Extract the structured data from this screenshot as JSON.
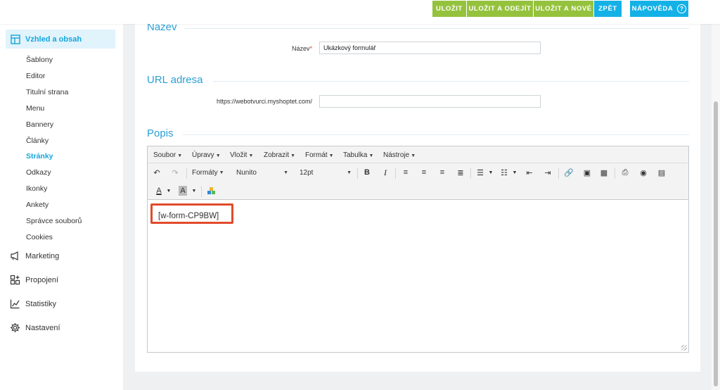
{
  "toolbar": {
    "save": "ULOŽIT",
    "save_exit": "ULOŽIT A ODEJÍT",
    "save_new": "ULOŽIT A NOVÉ",
    "back": "ZPĚT",
    "help": "NÁPOVĚDA",
    "help_icon_glyph": "?",
    "colors": {
      "green": "#95c23d",
      "blue": "#14b1e7"
    }
  },
  "sidebar": {
    "active_section": "Vzhled a obsah",
    "sub_items": [
      "Šablony",
      "Editor",
      "Titulní strana",
      "Menu",
      "Bannery",
      "Články",
      "Stránky",
      "Odkazy",
      "Ikonky",
      "Ankety",
      "Správce souborů",
      "Cookies"
    ],
    "current_sub": "Stránky",
    "main_items": [
      {
        "label": "Marketing",
        "icon": "megaphone-icon"
      },
      {
        "label": "Propojení",
        "icon": "grid-plus-icon"
      },
      {
        "label": "Statistiky",
        "icon": "chart-icon"
      },
      {
        "label": "Nastavení",
        "icon": "gear-icon"
      }
    ]
  },
  "form": {
    "name_section": "Název",
    "name_label": "Název",
    "name_required_mark": "*",
    "name_value": "Ukázkový formulář",
    "url_section": "URL adresa",
    "url_prefix": "https://webotvurci.myshoptet.com/",
    "url_value": "",
    "desc_section": "Popis"
  },
  "editor": {
    "menus": [
      "Soubor",
      "Úpravy",
      "Vložit",
      "Zobrazit",
      "Formát",
      "Tabulka",
      "Nástroje"
    ],
    "formats_label": "Formáty",
    "font_family": "Nunito",
    "font_size": "12pt",
    "content": "[w-form-CP9BW]",
    "highlight_color": "#e14b2c"
  }
}
